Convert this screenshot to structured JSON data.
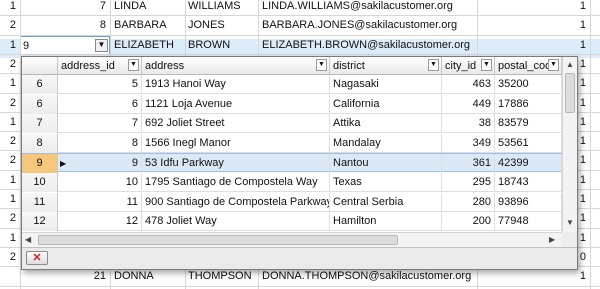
{
  "background_rows": [
    {
      "row_label": "1",
      "id": "7",
      "first": "LINDA",
      "last": "WILLIAMS",
      "email": "LINDA.WILLIAMS@sakilacustomer.org",
      "active": "1"
    },
    {
      "row_label": "2",
      "id": "8",
      "first": "BARBARA",
      "last": "JONES",
      "email": "BARBARA.JONES@sakilacustomer.org",
      "active": "1"
    },
    {
      "row_label": "1",
      "id": "9",
      "first": "ELIZABETH",
      "last": "BROWN",
      "email": "ELIZABETH.BROWN@sakilacustomer.org",
      "active": "1"
    },
    {
      "row_label": "2",
      "active": "1"
    },
    {
      "row_label": "1",
      "active": "1"
    },
    {
      "row_label": "2",
      "active": "1"
    },
    {
      "row_label": "1",
      "active": "1"
    },
    {
      "row_label": "2",
      "active": "1"
    },
    {
      "row_label": "2",
      "active": "1"
    },
    {
      "row_label": "1",
      "active": "1"
    },
    {
      "row_label": "1",
      "active": "1"
    },
    {
      "row_label": "2",
      "active": "1"
    },
    {
      "row_label": "1",
      "active": "1"
    },
    {
      "row_label": "2",
      "active": "0"
    },
    {
      "row_label": "",
      "id": "21",
      "first": "DONNA",
      "last": "THOMPSON",
      "email": "DONNA.THOMPSON@sakilacustomer.org",
      "active": "1"
    }
  ],
  "popup": {
    "columns": [
      "address_id",
      "address",
      "district",
      "city_id",
      "postal_code"
    ],
    "rows": [
      {
        "num": "6",
        "address_id": "5",
        "address": "1913 Hanoi Way",
        "district": "Nagasaki",
        "city_id": "463",
        "postal_code": "35200"
      },
      {
        "num": "6",
        "address_id": "6",
        "address": "1121 Loja Avenue",
        "district": "California",
        "city_id": "449",
        "postal_code": "17886"
      },
      {
        "num": "7",
        "address_id": "7",
        "address": "692 Joliet Street",
        "district": "Attika",
        "city_id": "38",
        "postal_code": "83579"
      },
      {
        "num": "8",
        "address_id": "8",
        "address": "1566 Inegl Manor",
        "district": "Mandalay",
        "city_id": "349",
        "postal_code": "53561"
      },
      {
        "num": "9",
        "address_id": "9",
        "address": "53 Idfu Parkway",
        "district": "Nantou",
        "city_id": "361",
        "postal_code": "42399"
      },
      {
        "num": "10",
        "address_id": "10",
        "address": "1795 Santiago de Compostela Way",
        "district": "Texas",
        "city_id": "295",
        "postal_code": "18743"
      },
      {
        "num": "11",
        "address_id": "11",
        "address": "900 Santiago de Compostela Parkway",
        "district": "Central Serbia",
        "city_id": "280",
        "postal_code": "93896"
      },
      {
        "num": "12",
        "address_id": "12",
        "address": "478 Joliet Way",
        "district": "Hamilton",
        "city_id": "200",
        "postal_code": "77948"
      }
    ],
    "selected_index": 4,
    "close_glyph": "✕",
    "row_pointer_glyph": "▶"
  },
  "colors": {
    "selection": "#dcecf9",
    "current_row_number": "#f4c77a",
    "close_x": "#d02020"
  }
}
